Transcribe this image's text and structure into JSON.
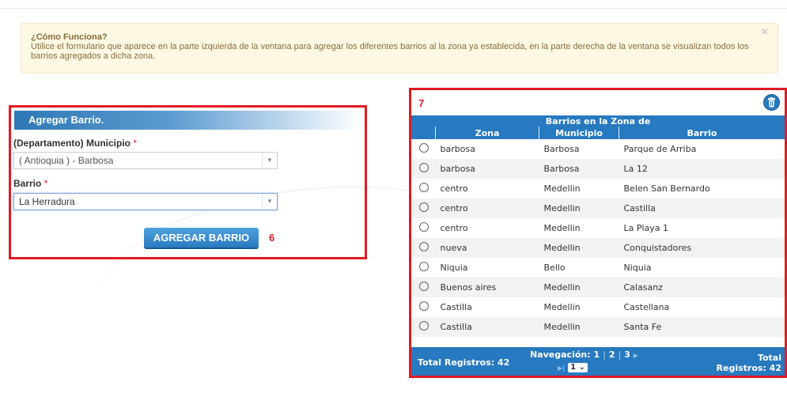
{
  "info": {
    "title": "¿Cómo Funciona?",
    "text": "Utilice el formulario que aparece en la parte izquierda de la ventana para agregar los diferentes barrios al la zona ya establecida, en la parte derecha de la ventana se visualizan todos los barrios agregados a dicha zona.",
    "close": "×"
  },
  "form": {
    "header": "Agregar Barrio.",
    "municipio_label": "(Departamento) Municipio",
    "municipio_value": "( Antioquia ) - Barbosa",
    "barrio_label": "Barrio",
    "barrio_value": "La Herradura",
    "required": "*",
    "button": "AGREGAR BARRIO",
    "marker": "6"
  },
  "table": {
    "marker": "7",
    "caption": "Barrios en la Zona de",
    "columns": [
      "Zona",
      "Municipio",
      "Barrio"
    ],
    "rows": [
      [
        "barbosa",
        "Barbosa",
        "Parque de Arriba"
      ],
      [
        "barbosa",
        "Barbosa",
        "La 12"
      ],
      [
        "centro",
        "Medellin",
        "Belen San Bernardo"
      ],
      [
        "centro",
        "Medellin",
        "Castilla"
      ],
      [
        "centro",
        "Medellin",
        "La Playa 1"
      ],
      [
        "nueva",
        "Medellin",
        "Conquistadores"
      ],
      [
        "Niquia",
        "Bello",
        "Niquia"
      ],
      [
        "Buenos aires",
        "Medellin",
        "Calasanz"
      ],
      [
        "Castilla",
        "Medellin",
        "Castellana"
      ],
      [
        "Castilla",
        "Medellin",
        "Santa Fe"
      ]
    ],
    "footer": {
      "total_label": "Total Registros: 42",
      "nav_label": "Navegación:",
      "pages": [
        "1",
        "2",
        "3"
      ],
      "page_select": "1",
      "total_right_1": "Total",
      "total_right_2": "Registros: 42"
    }
  },
  "colors": {
    "accent": "#2779c0",
    "highlight_border": "#e21a23",
    "alert_bg": "#fcf8e3"
  },
  "icons": {
    "delete": "trash-icon",
    "close": "close-icon",
    "dropdown": "chevron-down-icon"
  }
}
